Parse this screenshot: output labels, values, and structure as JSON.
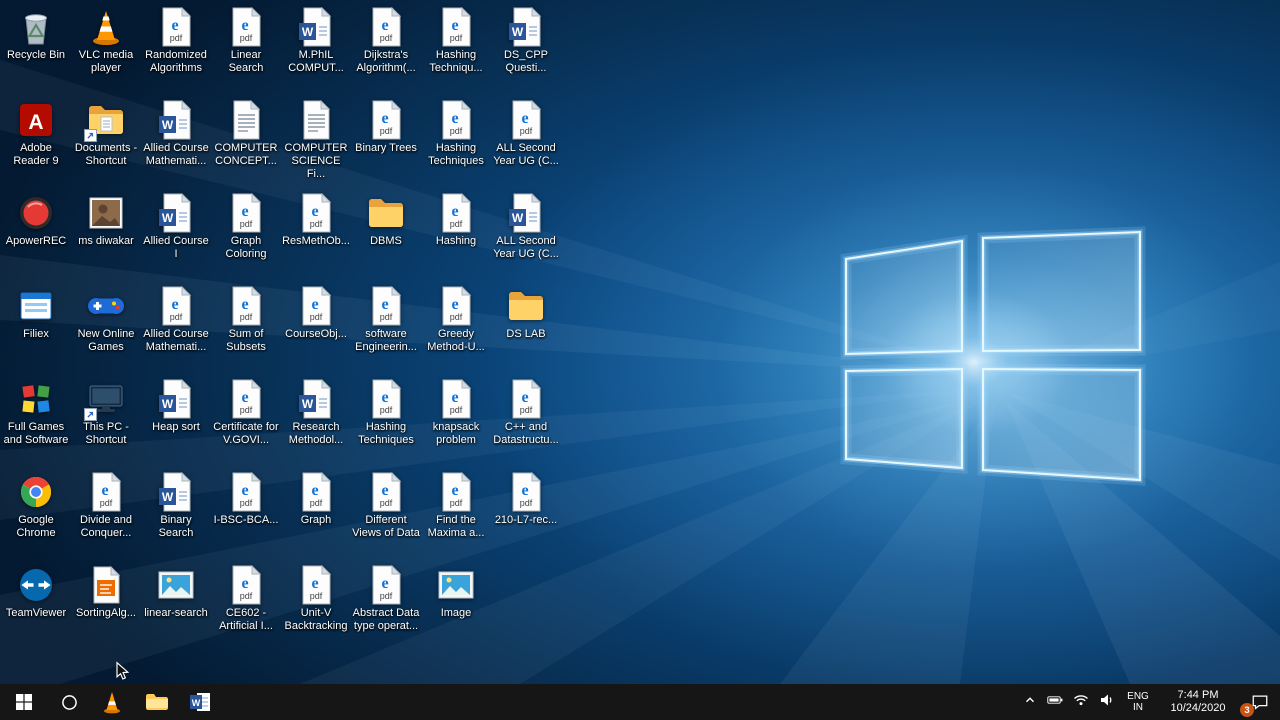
{
  "desktop": {
    "icons": [
      {
        "label": "Recycle Bin",
        "type": "recycle-bin"
      },
      {
        "label": "VLC media player",
        "type": "vlc"
      },
      {
        "label": "Randomized Algorithms",
        "type": "pdf"
      },
      {
        "label": "Linear Search",
        "type": "pdf"
      },
      {
        "label": "M.PhIL COMPUT...",
        "type": "word"
      },
      {
        "label": "Dijkstra's Algorithm(...",
        "type": "pdf"
      },
      {
        "label": "Hashing Techniqu...",
        "type": "pdf"
      },
      {
        "label": "DS_CPP Questi...",
        "type": "word"
      },
      {
        "label": "Adobe Reader 9",
        "type": "adobe"
      },
      {
        "label": "Documents - Shortcut",
        "type": "doc-folder",
        "shortcut": true
      },
      {
        "label": "Allied Course Mathemati...",
        "type": "word"
      },
      {
        "label": "COMPUTER CONCEPT...",
        "type": "textdoc"
      },
      {
        "label": "COMPUTER SCIENCE Fi...",
        "type": "textdoc"
      },
      {
        "label": "Binary Trees",
        "type": "pdf"
      },
      {
        "label": "Hashing Techniques",
        "type": "pdf"
      },
      {
        "label": "ALL Second Year UG (C...",
        "type": "pdf"
      },
      {
        "label": "ApowerREC",
        "type": "apowerrec"
      },
      {
        "label": "ms diwakar",
        "type": "photo"
      },
      {
        "label": "Allied Course I",
        "type": "word"
      },
      {
        "label": "Graph Coloring",
        "type": "pdf"
      },
      {
        "label": "ResMethOb...",
        "type": "pdf"
      },
      {
        "label": "DBMS",
        "type": "folder"
      },
      {
        "label": "Hashing",
        "type": "pdf"
      },
      {
        "label": "ALL Second Year UG (C...",
        "type": "word"
      },
      {
        "label": "Filiex",
        "type": "filiex"
      },
      {
        "label": "New Online Games",
        "type": "gamepad"
      },
      {
        "label": "Allied Course Mathemati...",
        "type": "pdf"
      },
      {
        "label": "Sum of Subsets",
        "type": "pdf"
      },
      {
        "label": "CourseObj...",
        "type": "pdf"
      },
      {
        "label": "software Engineerin...",
        "type": "pdf"
      },
      {
        "label": "Greedy Method-U...",
        "type": "pdf"
      },
      {
        "label": "DS LAB",
        "type": "folder"
      },
      {
        "label": "Full Games and Software",
        "type": "cubes"
      },
      {
        "label": "This PC - Shortcut",
        "type": "pc",
        "shortcut": true
      },
      {
        "label": "Heap sort",
        "type": "word"
      },
      {
        "label": "Certificate for V.GOVI...",
        "type": "pdf"
      },
      {
        "label": "Research Methodol...",
        "type": "word"
      },
      {
        "label": "Hashing Techniques",
        "type": "pdf"
      },
      {
        "label": "knapsack problem",
        "type": "pdf"
      },
      {
        "label": "C++ and Datastructu...",
        "type": "pdf"
      },
      {
        "label": "Google Chrome",
        "type": "chrome"
      },
      {
        "label": "Divide and Conquer...",
        "type": "pdf"
      },
      {
        "label": "Binary Search",
        "type": "word"
      },
      {
        "label": "I-BSC-BCA...",
        "type": "pdf"
      },
      {
        "label": "Graph",
        "type": "pdf"
      },
      {
        "label": "Different Views of Data",
        "type": "pdf"
      },
      {
        "label": "Find the Maxima a...",
        "type": "pdf"
      },
      {
        "label": "210-L7-rec...",
        "type": "pdf"
      },
      {
        "label": "TeamViewer",
        "type": "teamviewer"
      },
      {
        "label": "SortingAlg...",
        "type": "sortdoc"
      },
      {
        "label": "linear-search",
        "type": "image"
      },
      {
        "label": "CE602 - Artificial I...",
        "type": "pdf"
      },
      {
        "label": "Unit-V Backtracking",
        "type": "pdf"
      },
      {
        "label": "Abstract Data type operat...",
        "type": "pdf"
      },
      {
        "label": "Image",
        "type": "image"
      }
    ]
  },
  "taskbar": {
    "apps": [
      "vlc-app",
      "explorer",
      "word-app"
    ],
    "tray": {
      "icons": [
        "chevron-up",
        "battery",
        "network",
        "volume"
      ],
      "language_line1": "ENG",
      "language_line2": "IN",
      "time": "7:44 PM",
      "date": "10/24/2020",
      "notification_count": "3"
    }
  },
  "colors": {
    "taskbar_bg": "#161616",
    "badge": "#c85414",
    "wallpaper_dark": "#041a32",
    "wallpaper_glow": "#7cc4f0",
    "label_text": "#ffffff"
  }
}
